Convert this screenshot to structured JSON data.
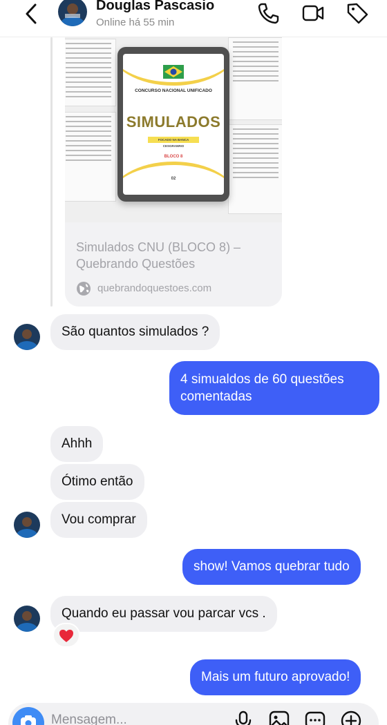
{
  "header": {
    "contact_name": "Douglas Pascasio",
    "status": "Online há 55 min"
  },
  "shared_link": {
    "title": "Simulados CNU (BLOCO 8) – Quebrando Questões",
    "domain": "quebrandoquestoes.com",
    "cover": {
      "heading": "CONCURSO NACIONAL UNIFICADO",
      "title": "SIMULADOS",
      "tagline": "FOCADO NA BANCA CESGRANRIO",
      "block": "BLOCO 8",
      "number": "02"
    }
  },
  "messages": [
    {
      "side": "incoming",
      "text": "São quantos simulados ?"
    },
    {
      "side": "outgoing",
      "text_line1": "4 simualdos de 60 questões",
      "text_line2": "comentadas"
    },
    {
      "side": "incoming",
      "text": "Ahhh"
    },
    {
      "side": "incoming",
      "text": "Ótimo então"
    },
    {
      "side": "incoming",
      "text": "Vou comprar"
    },
    {
      "side": "outgoing",
      "text": "show! Vamos quebrar tudo"
    },
    {
      "side": "incoming",
      "text": "Quando eu passar vou parcar vcs .",
      "reaction": "red-heart"
    },
    {
      "side": "outgoing",
      "text": "Mais um futuro aprovado!"
    }
  ],
  "composer": {
    "placeholder": "Mensagem..."
  },
  "colors": {
    "outgoing_bubble": "#3e5ff7",
    "incoming_bubble": "#efeff2",
    "camera_button": "#3f8cf5"
  }
}
